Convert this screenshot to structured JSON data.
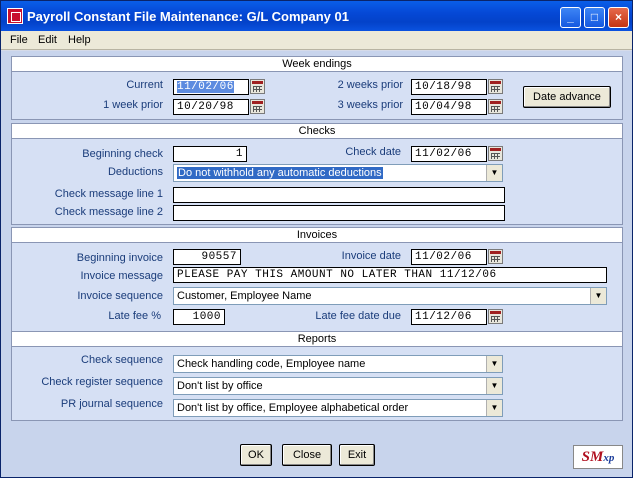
{
  "window": {
    "title": "Payroll Constant File Maintenance:  G/L Company 01"
  },
  "menu": {
    "file": "File",
    "edit": "Edit",
    "help": "Help"
  },
  "sections": {
    "week_endings": "Week endings",
    "checks": "Checks",
    "invoices": "Invoices",
    "reports": "Reports"
  },
  "week_endings": {
    "current_label": "Current",
    "current": "11/02/06",
    "week1_label": "1 week prior",
    "week1": "10/20/98",
    "week2_label": "2 weeks prior",
    "week2": "10/18/98",
    "week3_label": "3 weeks prior",
    "week3": "10/04/98",
    "date_advance": "Date advance"
  },
  "checks": {
    "beginning_check_label": "Beginning check",
    "beginning_check": "1",
    "check_date_label": "Check date",
    "check_date": "11/02/06",
    "deductions_label": "Deductions",
    "deductions": "Do not withhold any automatic deductions",
    "msg1_label": "Check message line 1",
    "msg1": "",
    "msg2_label": "Check message line 2",
    "msg2": ""
  },
  "invoices": {
    "beginning_invoice_label": "Beginning invoice",
    "beginning_invoice": "90557",
    "invoice_date_label": "Invoice date",
    "invoice_date": "11/02/06",
    "invoice_message_label": "Invoice message",
    "invoice_message": "PLEASE PAY THIS AMOUNT NO LATER THAN 11/12/06",
    "invoice_sequence_label": "Invoice sequence",
    "invoice_sequence": "Customer, Employee Name",
    "late_fee_label": "Late fee %",
    "late_fee": "1000",
    "late_fee_date_label": "Late fee date due",
    "late_fee_date": "11/12/06"
  },
  "reports": {
    "check_sequence_label": "Check sequence",
    "check_sequence": "Check handling code, Employee name",
    "register_sequence_label": "Check register sequence",
    "register_sequence": "Don't list by office",
    "pr_journal_label": "PR journal sequence",
    "pr_journal": "Don't list by office, Employee alphabetical order"
  },
  "buttons": {
    "ok": "OK",
    "close": "Close",
    "exit": "Exit"
  },
  "logo": {
    "text": "SM",
    "small": "xp"
  },
  "colors": {
    "titlebar": "#0548d6",
    "label": "#1a3c7a",
    "panel": "#d6e0f4",
    "selection": "#316ac5"
  }
}
